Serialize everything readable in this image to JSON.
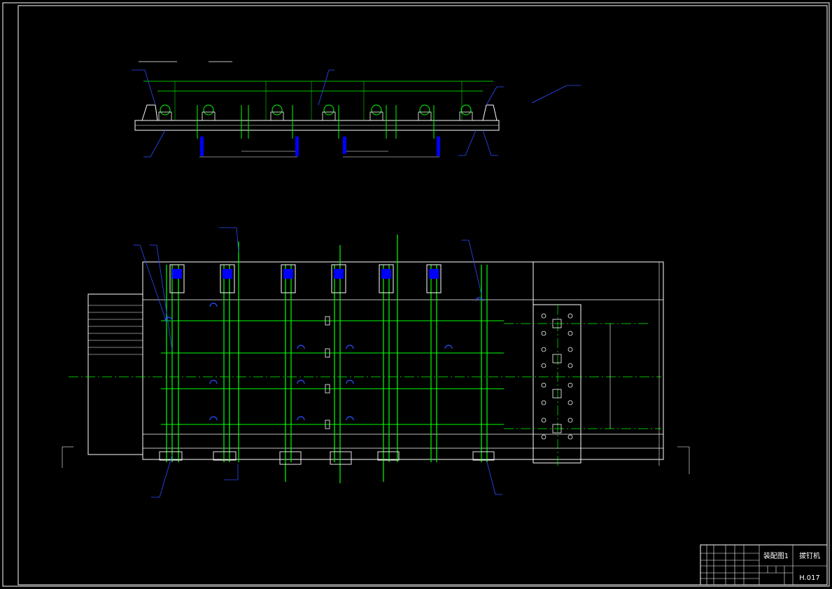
{
  "drawing": {
    "colors": {
      "background": "#000000",
      "outline": "#ffffff",
      "centerline": "#00ff00",
      "dimension": "#00ff00",
      "component": "#0000ff",
      "leader": "#2a4dff"
    }
  },
  "title_block": {
    "drawing_name": "装配图1",
    "machine_name": "拔钉机",
    "drawing_number": "H.017"
  }
}
